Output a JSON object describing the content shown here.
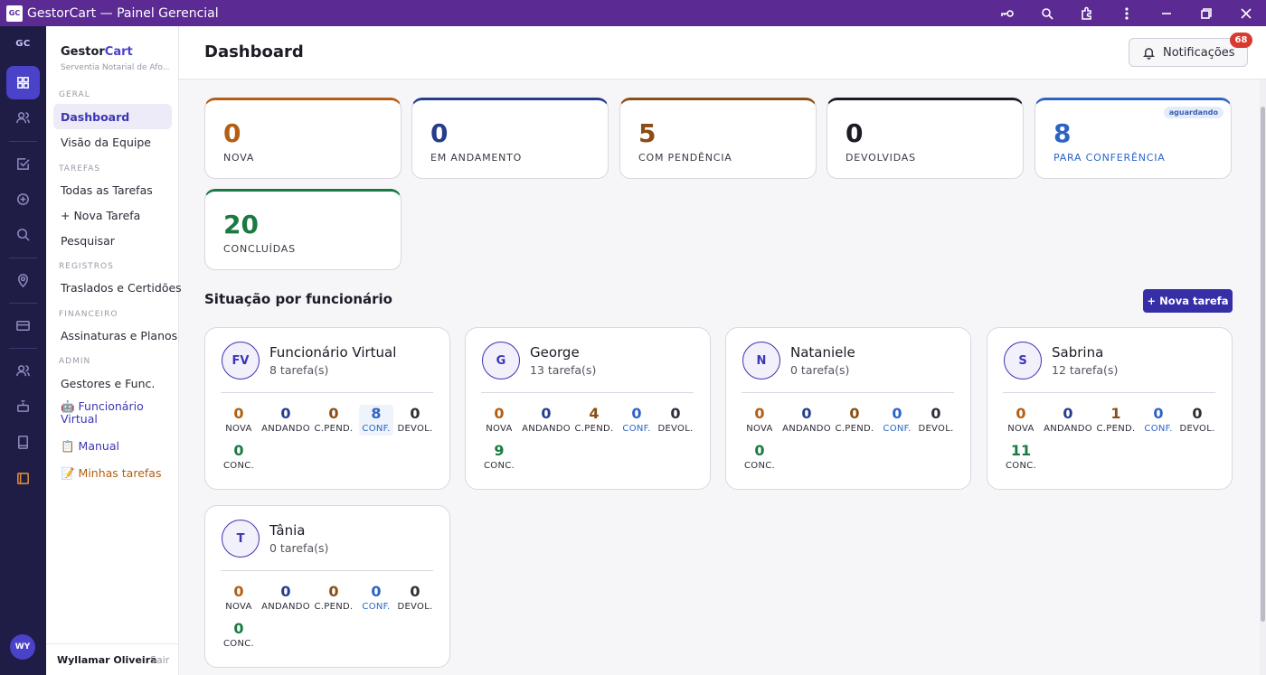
{
  "window": {
    "title": "GestorCart — Painel Gerencial",
    "logo": "GC"
  },
  "rail": {
    "brand": "GC",
    "avatar": "WY"
  },
  "sidebar": {
    "brand_a": "Gestor",
    "brand_b": "Cart",
    "brand_sub": "Serventia Notarial de Afo...",
    "sections": {
      "geral": "GERAL",
      "tarefas": "TAREFAS",
      "registros": "REGISTROS",
      "financeiro": "FINANCEIRO",
      "admin": "ADMIN"
    },
    "items": {
      "dashboard": "Dashboard",
      "visao_equipe": "Visão da Equipe",
      "todas_tarefas": "Todas as Tarefas",
      "nova_tarefa": "+ Nova Tarefa",
      "pesquisar": "Pesquisar",
      "traslados": "Traslados e Certidões",
      "assinaturas": "Assinaturas e Planos",
      "gestores": "Gestores e Func.",
      "funcionario_virtual": "🤖 Funcionário Virtual",
      "manual": "📋 Manual",
      "minhas_tarefas": "📝 Minhas tarefas"
    },
    "user_name": "Wyllamar Oliveira",
    "logout": "Sair"
  },
  "header": {
    "title": "Dashboard",
    "notifications_label": "Notificações",
    "notifications_count": "68"
  },
  "stats": [
    {
      "value": "0",
      "label": "NOVA",
      "color": "#b35e12"
    },
    {
      "value": "0",
      "label": "EM ANDAMENTO",
      "color": "#263d8c"
    },
    {
      "value": "5",
      "label": "COM PENDÊNCIA",
      "color": "#8a4d13"
    },
    {
      "value": "0",
      "label": "DEVOLVIDAS",
      "color": "#1c1b26"
    },
    {
      "value": "8",
      "label": "PARA CONFERÊNCIA",
      "color": "#2b64c4",
      "tag": "aguardando"
    },
    {
      "value": "20",
      "label": "CONCLUÍDAS",
      "color": "#1a7a42"
    }
  ],
  "employees_section": {
    "title": "Situação por funcionário",
    "new_task_button": "+ Nova tarefa"
  },
  "column_labels": {
    "nova": "NOVA",
    "andando": "ANDANDO",
    "cpend": "C.PEND.",
    "conf": "CONF.",
    "devol": "DEVOL.",
    "conc": "CONC."
  },
  "employees": [
    {
      "initials": "FV",
      "name": "Funcionário Virtual",
      "tasks": "8 tarefa(s)",
      "nova": "0",
      "andando": "0",
      "cpend": "0",
      "conf": "8",
      "devol": "0",
      "conc": "0"
    },
    {
      "initials": "G",
      "name": "George",
      "tasks": "13 tarefa(s)",
      "nova": "0",
      "andando": "0",
      "cpend": "4",
      "conf": "0",
      "devol": "0",
      "conc": "9"
    },
    {
      "initials": "N",
      "name": "Nataniele",
      "tasks": "0 tarefa(s)",
      "nova": "0",
      "andando": "0",
      "cpend": "0",
      "conf": "0",
      "devol": "0",
      "conc": "0"
    },
    {
      "initials": "S",
      "name": "Sabrina",
      "tasks": "12 tarefa(s)",
      "nova": "0",
      "andando": "0",
      "cpend": "1",
      "conf": "0",
      "devol": "0",
      "conc": "11"
    },
    {
      "initials": "T",
      "name": "Tânia",
      "tasks": "0 tarefa(s)",
      "nova": "0",
      "andando": "0",
      "cpend": "0",
      "conf": "0",
      "devol": "0",
      "conc": "0"
    }
  ]
}
